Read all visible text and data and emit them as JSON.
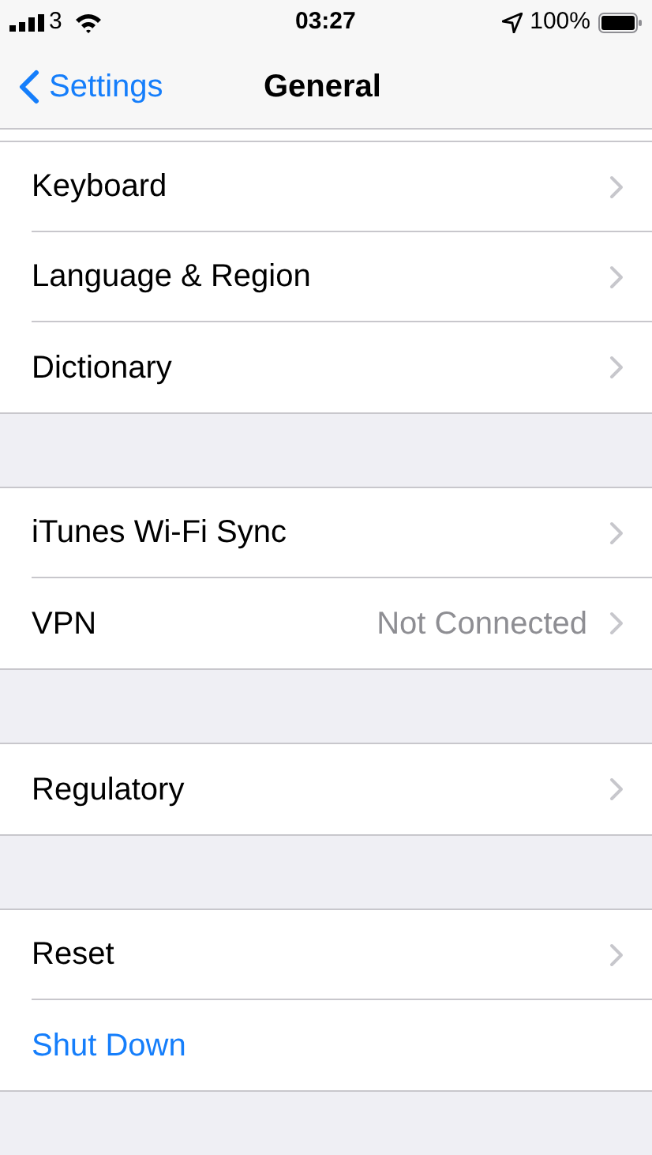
{
  "status_bar": {
    "carrier": "3",
    "time": "03:27",
    "battery": "100%"
  },
  "nav": {
    "back": "Settings",
    "title": "General"
  },
  "groups": [
    {
      "rows": [
        {
          "kind": "link",
          "label": "Keyboard"
        },
        {
          "kind": "link",
          "label": "Language & Region"
        },
        {
          "kind": "link",
          "label": "Dictionary"
        }
      ]
    },
    {
      "rows": [
        {
          "kind": "link",
          "label": "iTunes Wi-Fi Sync"
        },
        {
          "kind": "link",
          "label": "VPN",
          "value": "Not Connected"
        }
      ]
    },
    {
      "rows": [
        {
          "kind": "link",
          "label": "Regulatory"
        }
      ]
    },
    {
      "rows": [
        {
          "kind": "link",
          "label": "Reset"
        },
        {
          "kind": "action",
          "label": "Shut Down"
        }
      ]
    }
  ]
}
